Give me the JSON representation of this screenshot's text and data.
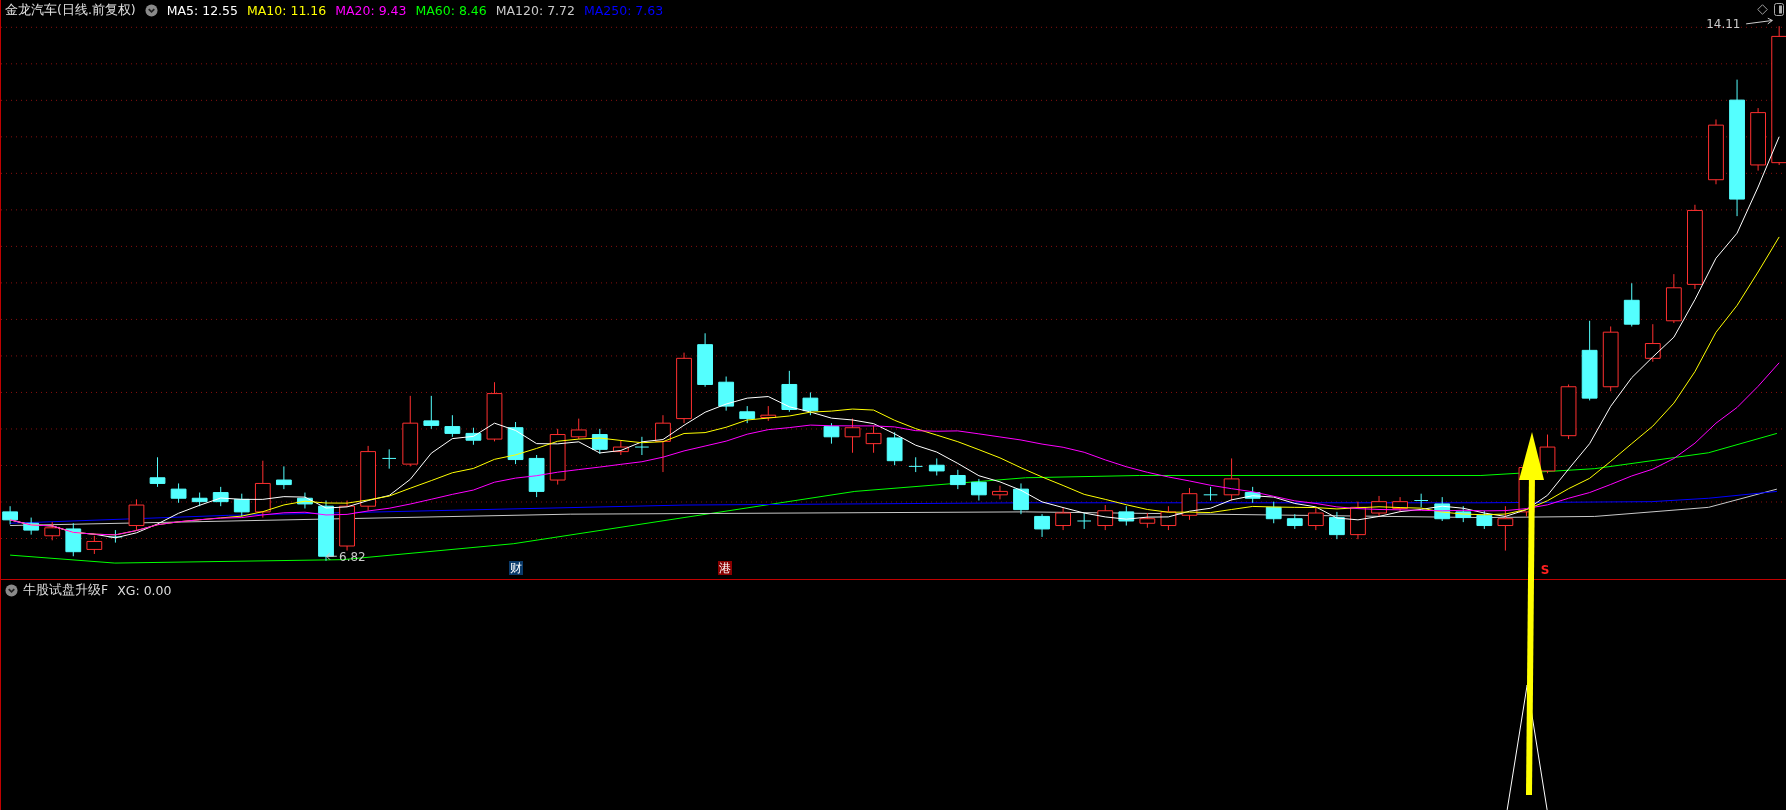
{
  "main_chart": {
    "title": "金龙汽车(日线.前复权)",
    "indicators": [
      {
        "label": "MA5: 12.55",
        "color": "#ffffff"
      },
      {
        "label": "MA10: 11.16",
        "color": "#ffff00"
      },
      {
        "label": "MA20: 9.43",
        "color": "#ff00ff"
      },
      {
        "label": "MA60: 8.46",
        "color": "#00ff00"
      },
      {
        "label": "MA120: 7.72",
        "color": "#c8c8c8"
      },
      {
        "label": "MA250: 7.63",
        "color": "#0000ff"
      }
    ],
    "price_labels": [
      {
        "kind": "high",
        "text": "14.11"
      },
      {
        "kind": "low",
        "text": "6.82"
      }
    ],
    "event_markers": [
      {
        "kind": "finance",
        "text": "财"
      },
      {
        "kind": "hk",
        "text": "港"
      },
      {
        "kind": "signal",
        "text": "S"
      }
    ]
  },
  "sub_chart": {
    "title": "牛股试盘升级F",
    "readout": "XG: 0.00"
  }
}
